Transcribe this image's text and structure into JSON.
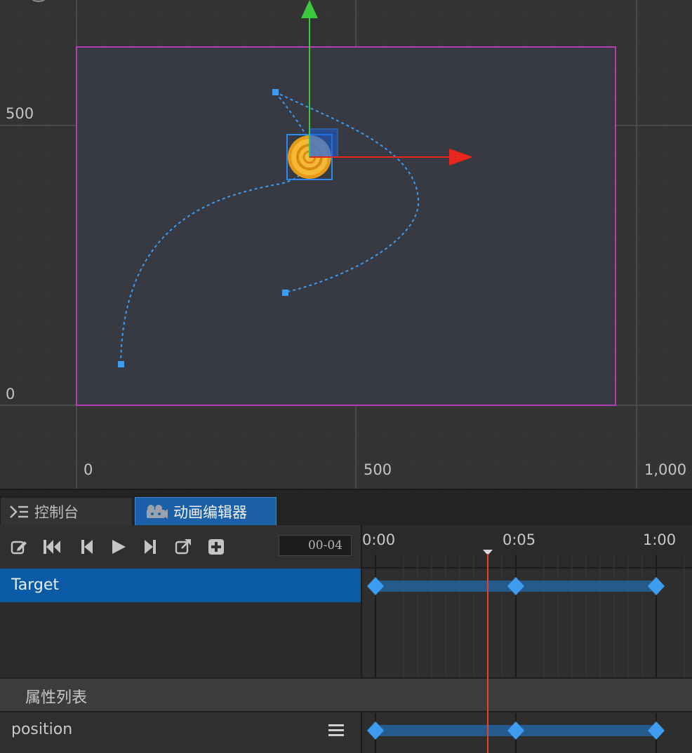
{
  "scene": {
    "ruler_y": [
      "500",
      "0"
    ],
    "ruler_x": [
      "0",
      "500",
      "1,000"
    ]
  },
  "tabs": [
    {
      "label": "控制台",
      "icon": "console-icon",
      "active": false
    },
    {
      "label": "动画编辑器",
      "icon": "animation-icon",
      "active": true
    }
  ],
  "toolbar": {
    "buttons": [
      "edit-icon",
      "jump-first-icon",
      "prev-frame-icon",
      "play-icon",
      "next-frame-icon",
      "export-icon",
      "add-icon"
    ],
    "time_value": "00-04"
  },
  "timeline": {
    "ticks": [
      "0:00",
      "0:05",
      "1:00"
    ]
  },
  "nodes": {
    "selected": "Target"
  },
  "properties": {
    "header": "属性列表",
    "items": [
      {
        "name": "position"
      }
    ]
  },
  "colors": {
    "accent": "#0b5aa6",
    "keyframe": "#3d9cf0",
    "playhead": "#e8412c",
    "canvas_border": "#b43cb4",
    "x_axis": "#e8261c",
    "y_axis": "#3cc83c"
  }
}
